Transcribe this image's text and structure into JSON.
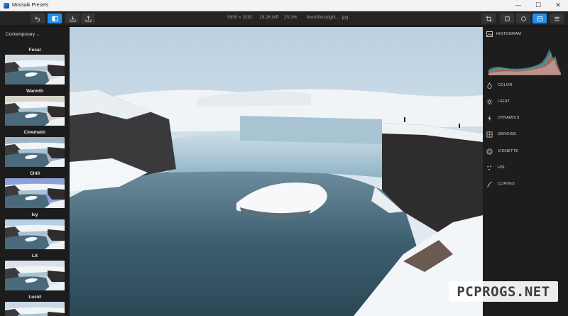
{
  "window": {
    "title": "Mossaik Presets",
    "minimize_glyph": "—",
    "maximize_glyph": "☐",
    "close_glyph": "✕"
  },
  "toolbar": {
    "dimensions": "5850 x 3282",
    "megapixels": "19.26 MP",
    "zoom": "25.3%",
    "filename": "lkxdnflknsdgfk... .jpg",
    "active_button_color": "#1d8ff0",
    "left_buttons": [
      "undo-icon",
      "compare-icon",
      "import-icon",
      "export-icon"
    ],
    "right_buttons": [
      "crop-icon",
      "square-mask-icon",
      "circle-mask-icon",
      "presets-view-icon",
      "menu-icon"
    ]
  },
  "presets": {
    "category": "Contemporary",
    "items": [
      {
        "label": "Focal",
        "tint": "#cfd9e0"
      },
      {
        "label": "Warmth",
        "tint": "#d8d3c8"
      },
      {
        "label": "Cinematic",
        "tint": "#9fb3c4"
      },
      {
        "label": "Chill",
        "tint": "#8ea0d8"
      },
      {
        "label": "Icy",
        "tint": "#b7cfe8"
      },
      {
        "label": "Lit",
        "tint": "#d9e2ea"
      },
      {
        "label": "Lucid",
        "tint": "#c9d8e6"
      }
    ]
  },
  "panel": {
    "histogram_label": "HISTOGRAM",
    "sections": [
      {
        "label": "COLOR",
        "icon": "drop-icon"
      },
      {
        "label": "LIGHT",
        "icon": "sun-icon"
      },
      {
        "label": "DYNAMICS",
        "icon": "bolt-icon"
      },
      {
        "label": "DENOISE",
        "icon": "grain-icon"
      },
      {
        "label": "VIGNETTE",
        "icon": "vignette-icon"
      },
      {
        "label": "HSL",
        "icon": "hsl-icon"
      },
      {
        "label": "CURVES",
        "icon": "curves-icon"
      }
    ]
  },
  "watermark": {
    "text": "PCPROGS.NET"
  }
}
